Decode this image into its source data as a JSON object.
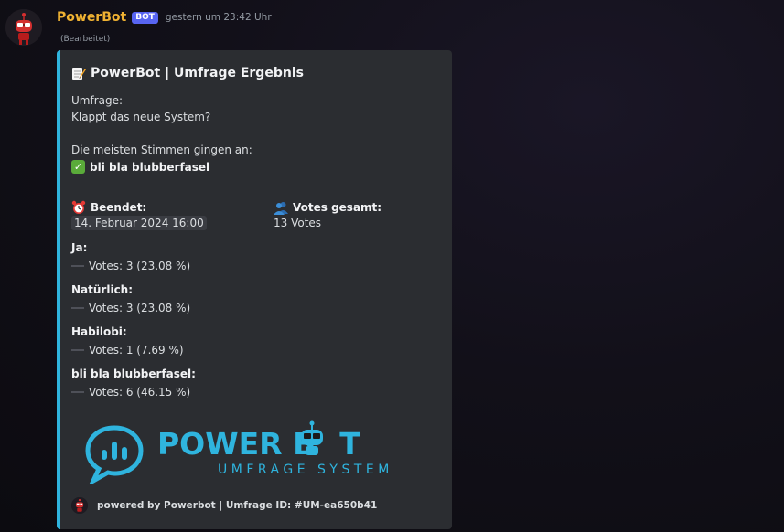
{
  "message": {
    "username": "PowerBot",
    "bot_tag": "BOT",
    "timestamp": "gestern um 23:42 Uhr",
    "edited": "(Bearbeitet)"
  },
  "embed": {
    "accent_color": "#2fb4de",
    "title_emoji": "memo-icon",
    "title": "PowerBot | Umfrage Ergebnis",
    "question_label": "Umfrage:",
    "question": "Klappt das neue System?",
    "most_votes_label": "Die meisten Stimmen gingen an:",
    "winner": "bli bla blubberfasel",
    "fields": {
      "ended_label": "Beendet:",
      "ended_value": "14. Februar 2024 16:00",
      "total_label": "Votes gesamt:",
      "total_value": "13 Votes"
    },
    "options": [
      {
        "name": "Ja:",
        "votes": "Votes: 3 (23.08 %)"
      },
      {
        "name": "Natürlich:",
        "votes": "Votes: 3 (23.08 %)"
      },
      {
        "name": "Habilobi:",
        "votes": "Votes: 1 (7.69 %)"
      },
      {
        "name": "bli bla blubberfasel:",
        "votes": "Votes: 6 (46.15 %)"
      }
    ],
    "image": {
      "logo_text_a": "POWER B",
      "logo_text_b": "T",
      "logo_subtitle": "UMFRAGE SYSTEM"
    },
    "footer": "powered by Powerbot | Umfrage ID: #UM-ea650b41"
  }
}
